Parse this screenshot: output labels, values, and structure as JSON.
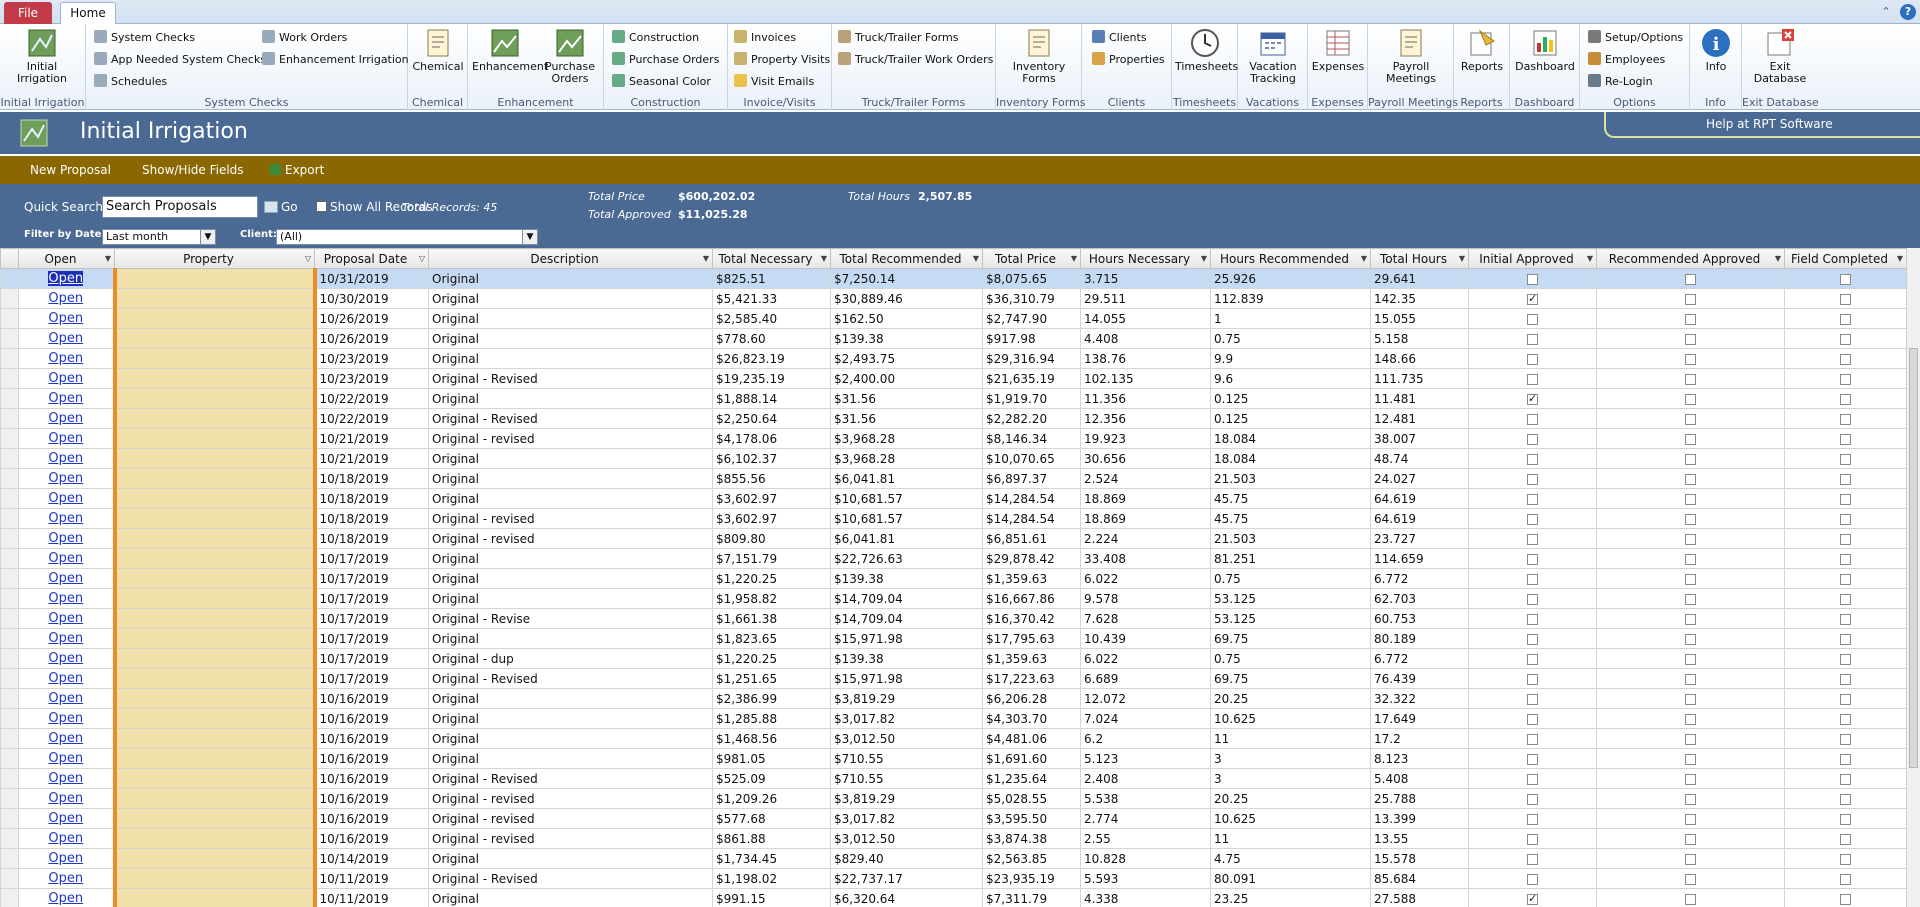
{
  "tabs": {
    "file": "File",
    "home": "Home"
  },
  "ribbon": {
    "groups": {
      "initial_irrigation": {
        "label": "Initial Irrigation",
        "button": "Initial Irrigation"
      },
      "system_checks": {
        "label": "System Checks",
        "items": [
          "System Checks",
          "App Needed System Checks",
          "Schedules",
          "Work Orders",
          "Enhancement Irrigation"
        ]
      },
      "chemical": {
        "label": "Chemical",
        "button": "Chemical"
      },
      "enhancement": {
        "label": "Enhancement",
        "buttons": [
          "Enhancement",
          "Purchase Orders"
        ]
      },
      "construction": {
        "label": "Construction",
        "items": [
          "Construction",
          "Purchase Orders",
          "Seasonal Color"
        ]
      },
      "invoice_visits": {
        "label": "Invoice/Visits",
        "items": [
          "Invoices",
          "Property Visits",
          "Visit Emails"
        ]
      },
      "truck_trailer": {
        "label": "Truck/Trailer Forms",
        "items": [
          "Truck/Trailer Forms",
          "Truck/Trailer Work Orders"
        ]
      },
      "inventory": {
        "label": "Inventory Forms",
        "button": "Inventory Forms"
      },
      "clients": {
        "label": "Clients",
        "items": [
          "Clients",
          "Properties"
        ]
      },
      "timesheets": {
        "label": "Timesheets",
        "button": "Timesheets"
      },
      "vacations": {
        "label": "Vacations",
        "button": "Vacation Tracking"
      },
      "expenses": {
        "label": "Expenses",
        "button": "Expenses"
      },
      "payroll": {
        "label": "Payroll Meetings",
        "button": "Payroll Meetings"
      },
      "reports": {
        "label": "Reports",
        "button": "Reports"
      },
      "dashboard": {
        "label": "Dashboard",
        "button": "Dashboard"
      },
      "options": {
        "label": "Options",
        "items": [
          "Setup/Options",
          "Employees",
          "Re-Login"
        ]
      },
      "info": {
        "label": "Info",
        "button": "Info"
      },
      "exit": {
        "label": "Exit Database",
        "button": "Exit Database"
      }
    }
  },
  "form": {
    "title": "Initial Irrigation",
    "help_link": "Help at RPT Software"
  },
  "actions": {
    "new_proposal": "New Proposal",
    "show_hide": "Show/Hide Fields",
    "export": "Export"
  },
  "filters": {
    "quick_search_label": "Quick Search:",
    "search_value": "Search Proposals",
    "go": "Go",
    "show_all": "Show All Records",
    "total_records": "Total Records: 45",
    "filter_date_label": "Filter by Date:",
    "filter_date_value": "Last month",
    "client_label": "Client:",
    "client_value": "(All)",
    "total_price_label": "Total Price",
    "total_price_value": "$600,202.02",
    "total_approved_label": "Total Approved",
    "total_approved_value": "$11,025.28",
    "total_hours_label": "Total Hours",
    "total_hours_value": "2,507.85"
  },
  "columns": [
    "Open",
    "Property",
    "Proposal Date",
    "Description",
    "Total Necessary",
    "Total Recommended",
    "Total Price",
    "Hours Necessary",
    "Hours Recommended",
    "Total Hours",
    "Initial Approved",
    "Recommended Approved",
    "Field Completed"
  ],
  "open_label": "Open",
  "rows": [
    [
      "10/31/2019",
      "Original",
      "$825.51",
      "$7,250.14",
      "$8,075.65",
      "3.715",
      "25.926",
      "29.641",
      false,
      false,
      false
    ],
    [
      "10/30/2019",
      "Original",
      "$5,421.33",
      "$30,889.46",
      "$36,310.79",
      "29.511",
      "112.839",
      "142.35",
      true,
      false,
      false
    ],
    [
      "10/26/2019",
      "Original",
      "$2,585.40",
      "$162.50",
      "$2,747.90",
      "14.055",
      "1",
      "15.055",
      false,
      false,
      false
    ],
    [
      "10/26/2019",
      "Original",
      "$778.60",
      "$139.38",
      "$917.98",
      "4.408",
      "0.75",
      "5.158",
      false,
      false,
      false
    ],
    [
      "10/23/2019",
      "Original",
      "$26,823.19",
      "$2,493.75",
      "$29,316.94",
      "138.76",
      "9.9",
      "148.66",
      false,
      false,
      false
    ],
    [
      "10/23/2019",
      "Original - Revised",
      "$19,235.19",
      "$2,400.00",
      "$21,635.19",
      "102.135",
      "9.6",
      "111.735",
      false,
      false,
      false
    ],
    [
      "10/22/2019",
      "Original",
      "$1,888.14",
      "$31.56",
      "$1,919.70",
      "11.356",
      "0.125",
      "11.481",
      true,
      false,
      false
    ],
    [
      "10/22/2019",
      "Original - Revised",
      "$2,250.64",
      "$31.56",
      "$2,282.20",
      "12.356",
      "0.125",
      "12.481",
      false,
      false,
      false
    ],
    [
      "10/21/2019",
      "Original - revised",
      "$4,178.06",
      "$3,968.28",
      "$8,146.34",
      "19.923",
      "18.084",
      "38.007",
      false,
      false,
      false
    ],
    [
      "10/21/2019",
      "Original",
      "$6,102.37",
      "$3,968.28",
      "$10,070.65",
      "30.656",
      "18.084",
      "48.74",
      false,
      false,
      false
    ],
    [
      "10/18/2019",
      "Original",
      "$855.56",
      "$6,041.81",
      "$6,897.37",
      "2.524",
      "21.503",
      "24.027",
      false,
      false,
      false
    ],
    [
      "10/18/2019",
      "Original",
      "$3,602.97",
      "$10,681.57",
      "$14,284.54",
      "18.869",
      "45.75",
      "64.619",
      false,
      false,
      false
    ],
    [
      "10/18/2019",
      "Original - revised",
      "$3,602.97",
      "$10,681.57",
      "$14,284.54",
      "18.869",
      "45.75",
      "64.619",
      false,
      false,
      false
    ],
    [
      "10/18/2019",
      "Original - revised",
      "$809.80",
      "$6,041.81",
      "$6,851.61",
      "2.224",
      "21.503",
      "23.727",
      false,
      false,
      false
    ],
    [
      "10/17/2019",
      "Original",
      "$7,151.79",
      "$22,726.63",
      "$29,878.42",
      "33.408",
      "81.251",
      "114.659",
      false,
      false,
      false
    ],
    [
      "10/17/2019",
      "Original",
      "$1,220.25",
      "$139.38",
      "$1,359.63",
      "6.022",
      "0.75",
      "6.772",
      false,
      false,
      false
    ],
    [
      "10/17/2019",
      "Original",
      "$1,958.82",
      "$14,709.04",
      "$16,667.86",
      "9.578",
      "53.125",
      "62.703",
      false,
      false,
      false
    ],
    [
      "10/17/2019",
      "Original - Revise",
      "$1,661.38",
      "$14,709.04",
      "$16,370.42",
      "7.628",
      "53.125",
      "60.753",
      false,
      false,
      false
    ],
    [
      "10/17/2019",
      "Original",
      "$1,823.65",
      "$15,971.98",
      "$17,795.63",
      "10.439",
      "69.75",
      "80.189",
      false,
      false,
      false
    ],
    [
      "10/17/2019",
      "Original - dup",
      "$1,220.25",
      "$139.38",
      "$1,359.63",
      "6.022",
      "0.75",
      "6.772",
      false,
      false,
      false
    ],
    [
      "10/17/2019",
      "Original - Revised",
      "$1,251.65",
      "$15,971.98",
      "$17,223.63",
      "6.689",
      "69.75",
      "76.439",
      false,
      false,
      false
    ],
    [
      "10/16/2019",
      "Original",
      "$2,386.99",
      "$3,819.29",
      "$6,206.28",
      "12.072",
      "20.25",
      "32.322",
      false,
      false,
      false
    ],
    [
      "10/16/2019",
      "Original",
      "$1,285.88",
      "$3,017.82",
      "$4,303.70",
      "7.024",
      "10.625",
      "17.649",
      false,
      false,
      false
    ],
    [
      "10/16/2019",
      "Original",
      "$1,468.56",
      "$3,012.50",
      "$4,481.06",
      "6.2",
      "11",
      "17.2",
      false,
      false,
      false
    ],
    [
      "10/16/2019",
      "Original",
      "$981.05",
      "$710.55",
      "$1,691.60",
      "5.123",
      "3",
      "8.123",
      false,
      false,
      false
    ],
    [
      "10/16/2019",
      "Original - Revised",
      "$525.09",
      "$710.55",
      "$1,235.64",
      "2.408",
      "3",
      "5.408",
      false,
      false,
      false
    ],
    [
      "10/16/2019",
      "Original - revised",
      "$1,209.26",
      "$3,819.29",
      "$5,028.55",
      "5.538",
      "20.25",
      "25.788",
      false,
      false,
      false
    ],
    [
      "10/16/2019",
      "Original - revised",
      "$577.68",
      "$3,017.82",
      "$3,595.50",
      "2.774",
      "10.625",
      "13.399",
      false,
      false,
      false
    ],
    [
      "10/16/2019",
      "Original - revised",
      "$861.88",
      "$3,012.50",
      "$3,874.38",
      "2.55",
      "11",
      "13.55",
      false,
      false,
      false
    ],
    [
      "10/14/2019",
      "Original",
      "$1,734.45",
      "$829.40",
      "$2,563.85",
      "10.828",
      "4.75",
      "15.578",
      false,
      false,
      false
    ],
    [
      "10/11/2019",
      "Original - Revised",
      "$1,198.02",
      "$22,737.17",
      "$23,935.19",
      "5.593",
      "80.091",
      "85.684",
      false,
      false,
      false
    ],
    [
      "10/11/2019",
      "Original",
      "$991.15",
      "$6,320.64",
      "$7,311.79",
      "4.338",
      "23.25",
      "27.588",
      true,
      false,
      false
    ]
  ],
  "colors": {
    "header_blue": "#4a6a93",
    "action_bar": "#8a6700",
    "property_fill": "#f1e0a9",
    "property_border": "#f08a24"
  }
}
